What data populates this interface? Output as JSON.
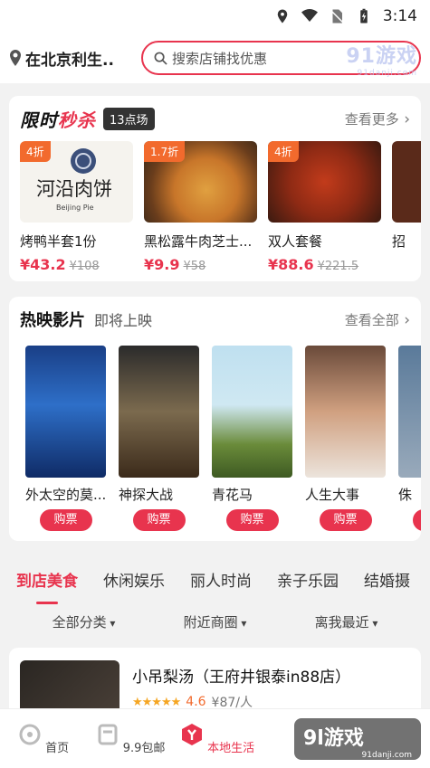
{
  "status": {
    "time": "3:14"
  },
  "header": {
    "location": "在北京利生..",
    "search_placeholder": "搜索店铺找优惠",
    "watermark": "91游戏",
    "watermark_url": "91danji.com"
  },
  "flash_sale": {
    "title_black": "限时",
    "title_red": "秒杀",
    "badge": "13点场",
    "more": "查看更多",
    "items": [
      {
        "discount": "4折",
        "name": "烤鸭半套1份",
        "price": "¥43.2",
        "old": "¥108",
        "logo_text": "河沿肉饼",
        "logo_sub": "Beijing Pie"
      },
      {
        "discount": "1.7折",
        "name": "黑松露牛肉芝士...",
        "price": "¥9.9",
        "old": "¥58"
      },
      {
        "discount": "4折",
        "name": "双人套餐",
        "price": "¥88.6",
        "old": "¥221.5"
      },
      {
        "discount": "",
        "name": "招",
        "price": "",
        "old": ""
      }
    ]
  },
  "movies": {
    "title": "热映影片",
    "subtitle": "即将上映",
    "more": "查看全部",
    "buy_label": "购票",
    "items": [
      {
        "name": "外太空的莫..."
      },
      {
        "name": "神探大战"
      },
      {
        "name": "青花马"
      },
      {
        "name": "人生大事"
      },
      {
        "name": "侏"
      }
    ]
  },
  "categories": [
    "到店美食",
    "休闲娱乐",
    "丽人时尚",
    "亲子乐园",
    "结婚摄"
  ],
  "filters": [
    "全部分类",
    "附近商圈",
    "离我最近"
  ],
  "store": {
    "name": "小吊梨汤（王府井银泰in88店）",
    "stars": "★★★★★",
    "rating": "4.6",
    "avg": "¥87/人"
  },
  "bottom_nav": [
    {
      "label": "首页"
    },
    {
      "label": "9.9包邮"
    },
    {
      "label": "本地生活"
    }
  ],
  "watermark_bottom": {
    "text": "9l游戏",
    "url": "91danji.com"
  },
  "colors": {
    "accent": "#e8344e",
    "discount": "#f26a2d"
  }
}
